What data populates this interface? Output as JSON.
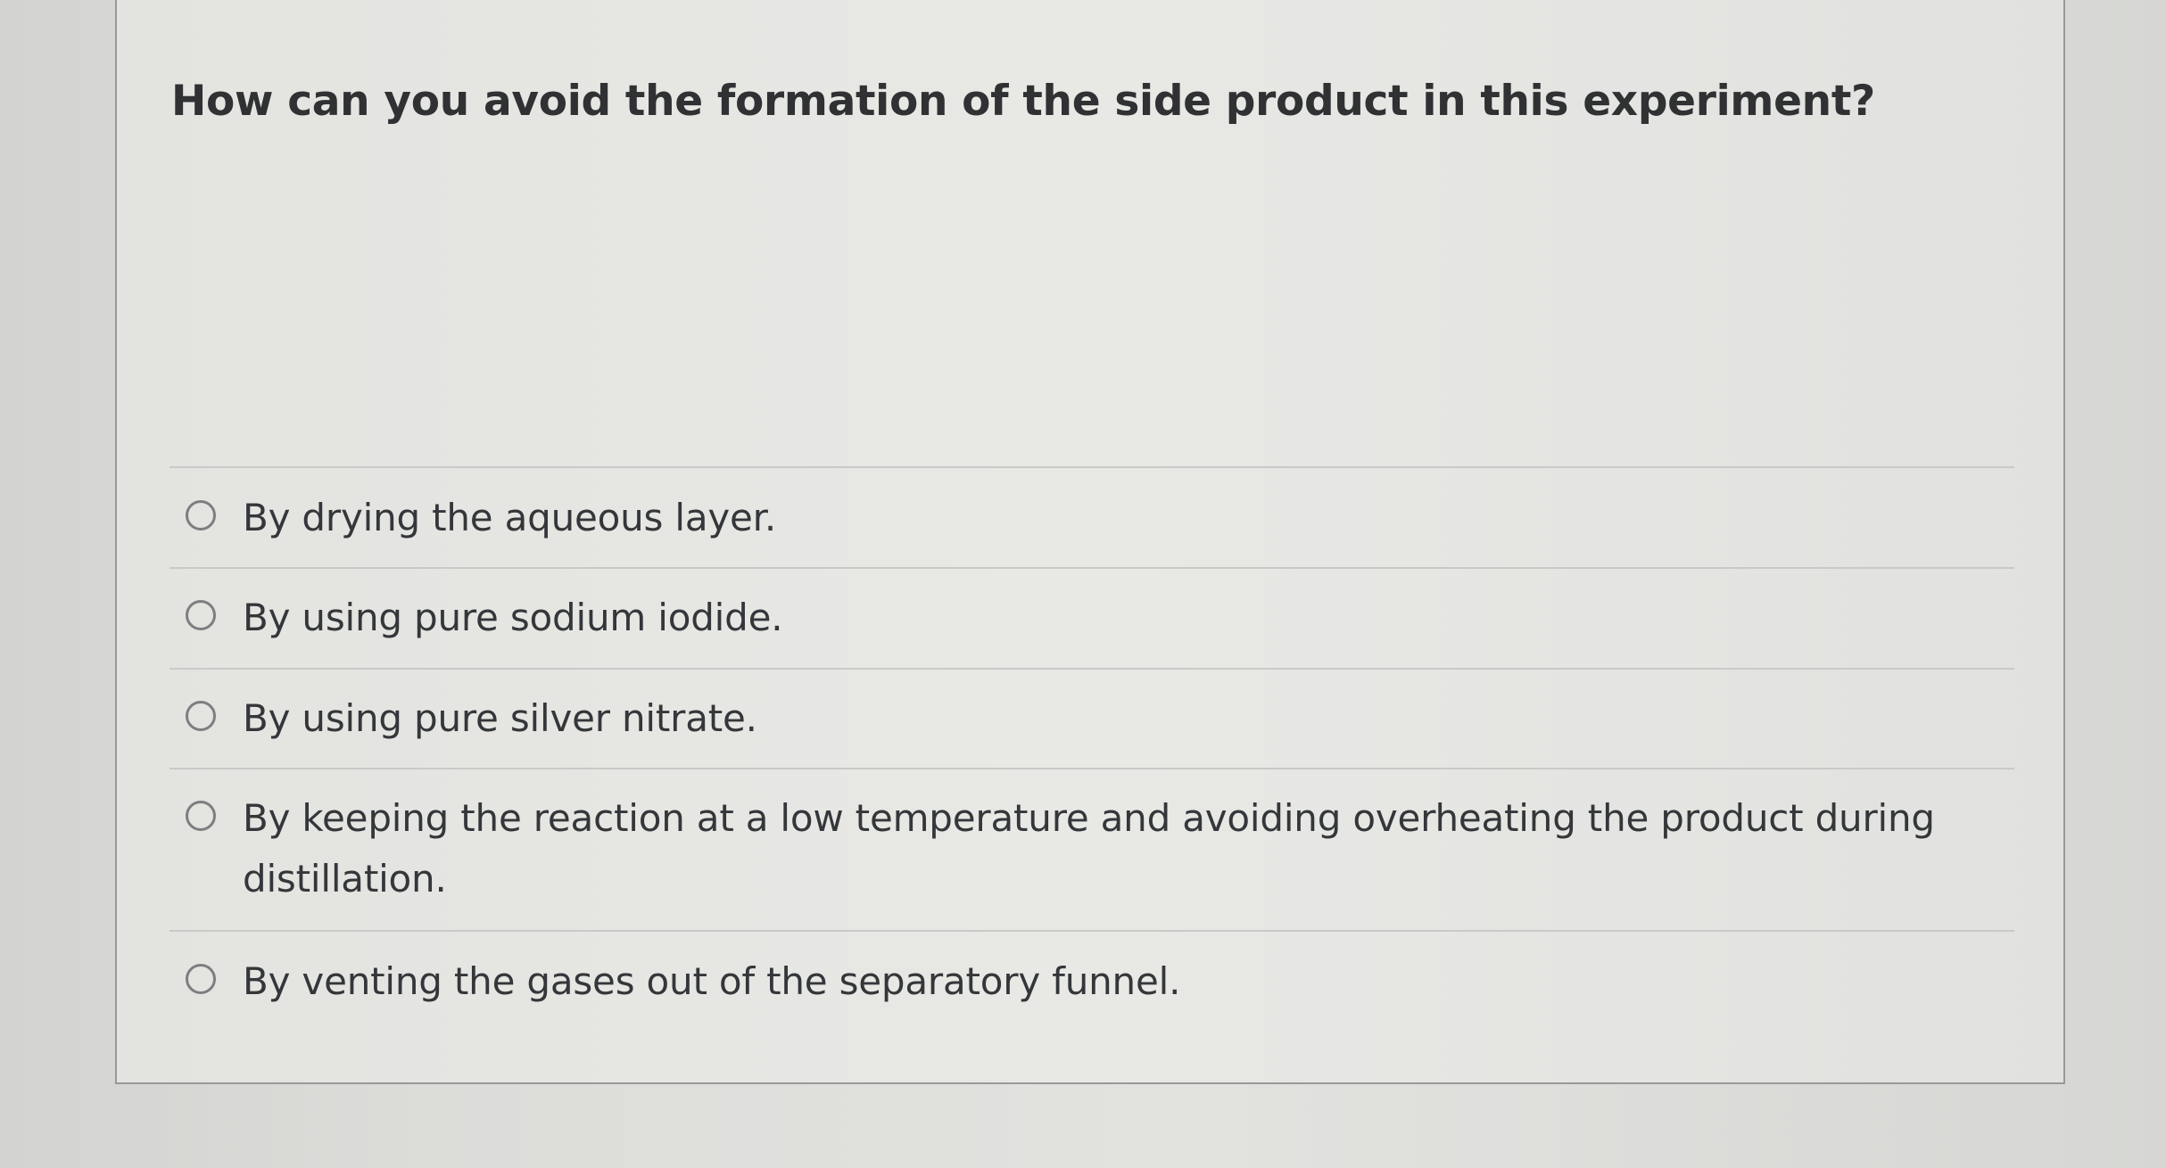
{
  "question": {
    "text": "How can you avoid the formation of the side product in this experiment?"
  },
  "options": [
    {
      "label": "By drying the aqueous layer.",
      "selected": false
    },
    {
      "label": "By using pure sodium iodide.",
      "selected": false
    },
    {
      "label": "By using pure silver nitrate.",
      "selected": false
    },
    {
      "label": "By keeping the reaction at a low temperature and avoiding overheating the product during distillation.",
      "selected": false
    },
    {
      "label": "By venting the gases out of the separatory funnel.",
      "selected": false
    }
  ]
}
